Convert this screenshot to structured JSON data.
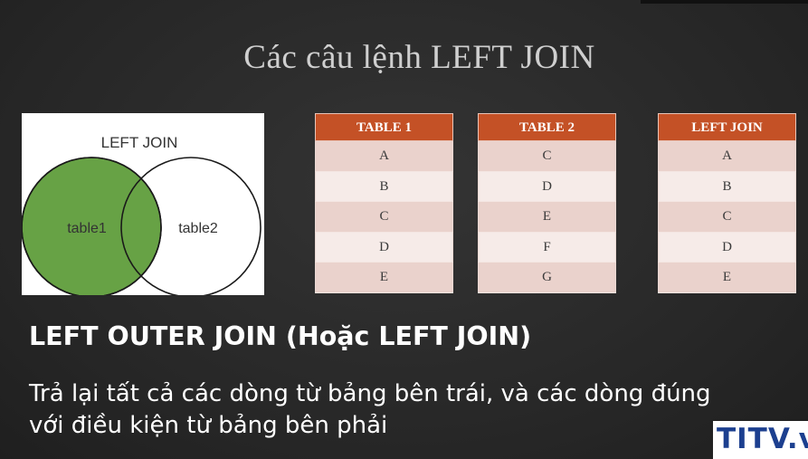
{
  "slide": {
    "title": "Các câu lệnh LEFT JOIN",
    "heading": "LEFT OUTER JOIN (Hoặc LEFT JOIN)",
    "description_line1": "Trả lại tất cả các dòng từ bảng bên trái, và các dòng đúng",
    "description_line2": "với điều kiện từ bảng bên phải"
  },
  "venn": {
    "title": "LEFT JOIN",
    "left_label": "table1",
    "right_label": "table2",
    "fill_color": "#67a245"
  },
  "tables": [
    {
      "header": "TABLE 1",
      "rows": [
        "A",
        "B",
        "C",
        "D",
        "E"
      ]
    },
    {
      "header": "TABLE 2",
      "rows": [
        "C",
        "D",
        "E",
        "F",
        "G"
      ]
    },
    {
      "header": "LEFT JOIN",
      "rows": [
        "A",
        "B",
        "C",
        "D",
        "E"
      ]
    }
  ],
  "colors": {
    "header_bg": "#c45126",
    "row_odd": "#ead2cc",
    "row_even": "#f6ebe8",
    "logo_text": "#1c3f8f"
  },
  "logo": {
    "text": "TITV.v"
  }
}
